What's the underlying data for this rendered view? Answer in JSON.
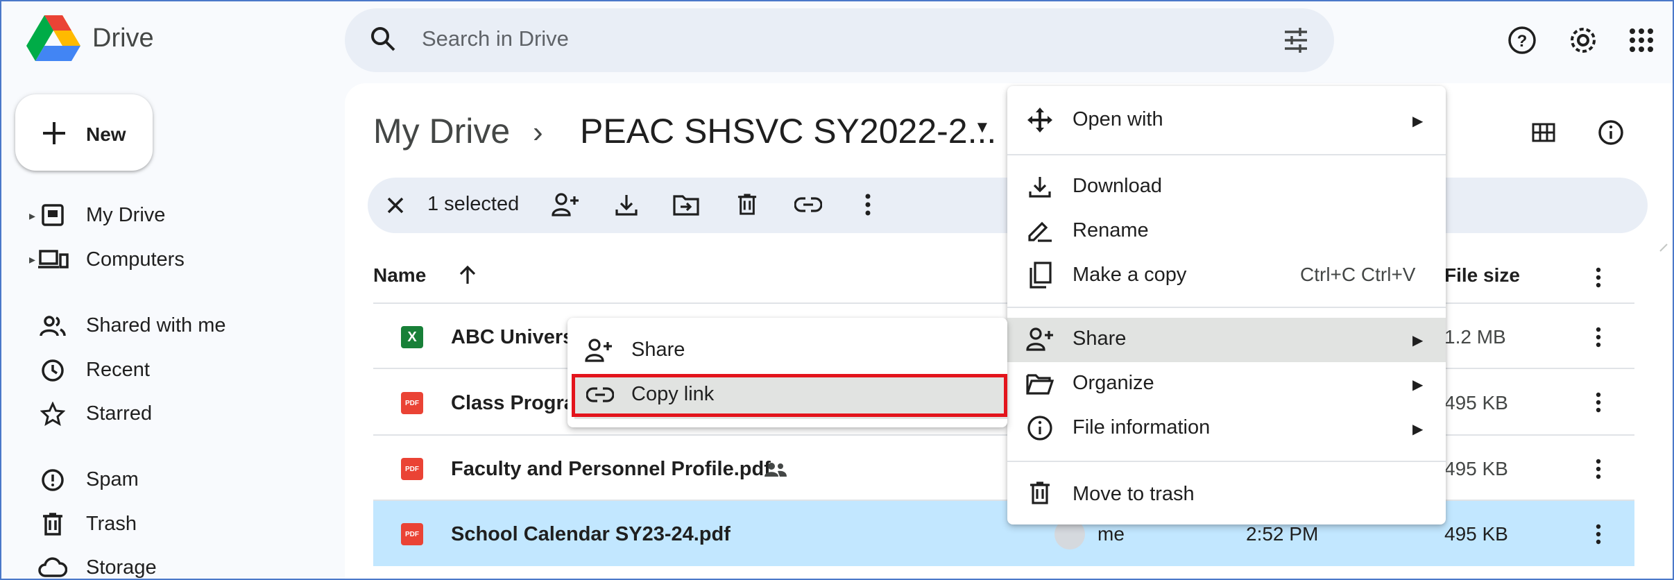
{
  "app": {
    "brand": "Drive"
  },
  "search": {
    "placeholder": "Search in Drive"
  },
  "sidebar": {
    "new_label": "New",
    "items": [
      {
        "label": "My Drive",
        "icon": "my-drive-icon"
      },
      {
        "label": "Computers",
        "icon": "computers-icon"
      },
      {
        "label": "Shared with me",
        "icon": "shared-icon"
      },
      {
        "label": "Recent",
        "icon": "clock-icon"
      },
      {
        "label": "Starred",
        "icon": "star-icon"
      },
      {
        "label": "Spam",
        "icon": "spam-icon"
      },
      {
        "label": "Trash",
        "icon": "trash-icon"
      },
      {
        "label": "Storage",
        "icon": "cloud-icon"
      }
    ]
  },
  "breadcrumb": {
    "root": "My Drive",
    "separator": "›",
    "current": "PEAC SHSVC SY2022-2..."
  },
  "selection": {
    "count": "1 selected"
  },
  "table": {
    "headers": {
      "name": "Name",
      "file_size": "File size"
    },
    "rows": [
      {
        "name": "ABC Universi",
        "type": "xlsx",
        "icon_letter": "X",
        "size": "1.2 MB"
      },
      {
        "name": "Class Progra",
        "type": "pdf",
        "icon_letter": "PDF",
        "size": "495 KB"
      },
      {
        "name": "Faculty and Personnel Profile.pdf",
        "type": "pdf",
        "icon_letter": "PDF",
        "size": "495 KB"
      },
      {
        "name": "School Calendar SY23-24.pdf",
        "type": "pdf",
        "icon_letter": "PDF",
        "owner": "me",
        "modified": "2:52 PM",
        "size": "495 KB",
        "selected": true
      }
    ]
  },
  "context_menu": {
    "items": [
      {
        "label": "Open with",
        "icon": "open-with-icon",
        "submenu": true
      },
      {
        "label": "Download",
        "icon": "download-icon"
      },
      {
        "label": "Rename",
        "icon": "rename-icon"
      },
      {
        "label": "Make a copy",
        "icon": "copy-icon",
        "shortcut": "Ctrl+C Ctrl+V"
      },
      {
        "label": "Share",
        "icon": "share-icon",
        "submenu": true,
        "highlighted": true
      },
      {
        "label": "Organize",
        "icon": "organize-icon",
        "submenu": true
      },
      {
        "label": "File information",
        "icon": "info-icon",
        "submenu": true
      },
      {
        "label": "Move to trash",
        "icon": "trash-icon"
      }
    ]
  },
  "share_submenu": {
    "items": [
      {
        "label": "Share",
        "icon": "share-person-icon"
      },
      {
        "label": "Copy link",
        "icon": "link-icon",
        "highlighted": true
      }
    ]
  },
  "colors": {
    "selected_row": "#c2e7ff",
    "highlight_box": "#e3141c",
    "pdf": "#ea4335",
    "xlsx": "#188038"
  }
}
